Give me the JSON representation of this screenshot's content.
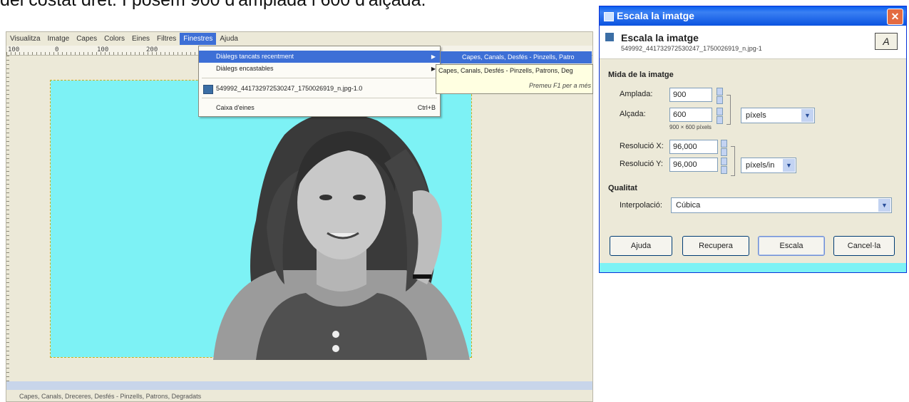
{
  "caption": "del costat dret. I posem 900 d'amplada i 600 d'alçada.",
  "gimp": {
    "menu": [
      "Visualitza",
      "Imatge",
      "Capes",
      "Colors",
      "Eines",
      "Filtres",
      "Finestres",
      "Ajuda"
    ],
    "active_menu": "Finestres",
    "ruler_ticks": [
      "100",
      "0",
      "100",
      "200"
    ],
    "statusbar": "Capes, Canals, Dreceres, Desfés - Pinzells, Patrons, Degradats"
  },
  "dropdown": {
    "item1": "Diàlegs tancats recentment",
    "item2": "Diàlegs encastables",
    "item3": "549992_441732972530247_1750026919_n.jpg-1.0",
    "item4": "Caixa d'eines",
    "item4_shortcut": "Ctrl+B",
    "submenu": "Capes, Canals, Desfés - Pinzells, Patro",
    "tooltip_line1": "Capes, Canals, Desfés - Pinzells, Patrons, Deg",
    "tooltip_line2": "Premeu F1 per a més"
  },
  "dialog": {
    "title": "Escala la imatge",
    "header_title": "Escala la imatge",
    "header_subtitle": "549992_441732972530247_1750026919_n.jpg-1",
    "section_size": "Mida de la imatge",
    "width_label": "Amplada:",
    "width_value": "900",
    "height_label": "Alçada:",
    "height_value": "600",
    "size_unit": "píxels",
    "size_readout": "900 × 600 píxels",
    "res_x_label": "Resolució X:",
    "res_x_value": "96,000",
    "res_y_label": "Resolució Y:",
    "res_y_value": "96,000",
    "res_unit": "píxels/in",
    "section_quality": "Qualitat",
    "interp_label": "Interpolació:",
    "interp_value": "Cúbica",
    "btn_help": "Ajuda",
    "btn_reset": "Recupera",
    "btn_scale": "Escala",
    "btn_cancel": "Cancel·la"
  }
}
